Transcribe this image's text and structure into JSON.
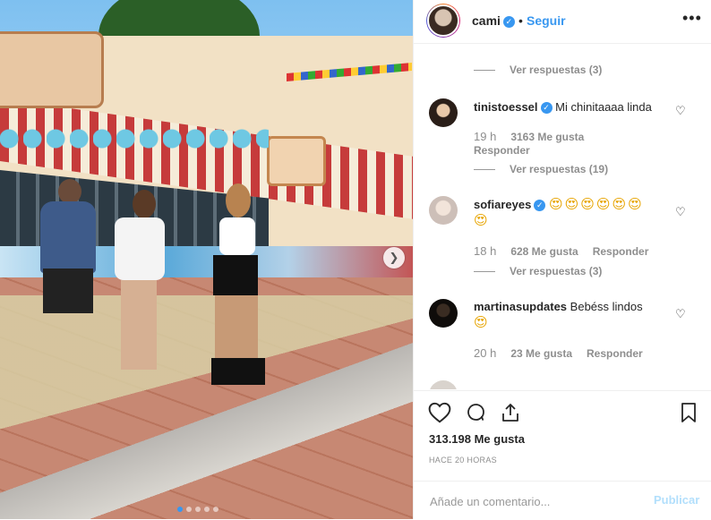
{
  "header": {
    "username": "cami",
    "separator": "•",
    "follow_label": "Seguir",
    "more_label": "•••"
  },
  "comments": [
    {
      "type": "view_replies",
      "label": "Ver respuestas (3)"
    },
    {
      "username": "tinistoessel",
      "verified": true,
      "text": "Mi chinitaaaa linda",
      "time": "19 h",
      "likes": "3163 Me gusta",
      "reply": "Responder",
      "view_replies": "Ver respuestas (19)"
    },
    {
      "username": "sofiareyes",
      "verified": true,
      "text": "😍😍😍😍😍😍",
      "text_line2": "😍",
      "time": "18 h",
      "likes": "628 Me gusta",
      "reply": "Responder",
      "view_replies": "Ver respuestas (3)"
    },
    {
      "username": "martinasupdates",
      "verified": false,
      "text": "Bebéss lindos",
      "text_line2": "😍",
      "time": "20 h",
      "likes": "23 Me gusta",
      "reply": "Responder"
    }
  ],
  "actions": {
    "like_icon": "heart-icon",
    "comment_icon": "comment-icon",
    "share_icon": "share-icon",
    "save_icon": "bookmark-icon"
  },
  "likes_count": "313.198 Me gusta",
  "time_ago": "HACE 20 HORAS",
  "composer": {
    "placeholder": "Añade un comentario...",
    "publish_label": "Publicar"
  },
  "carousel": {
    "total": 5,
    "active": 0
  },
  "colors": {
    "accent": "#3897f0",
    "muted": "#8e8e8e",
    "publish_disabled": "#b2dffc"
  }
}
